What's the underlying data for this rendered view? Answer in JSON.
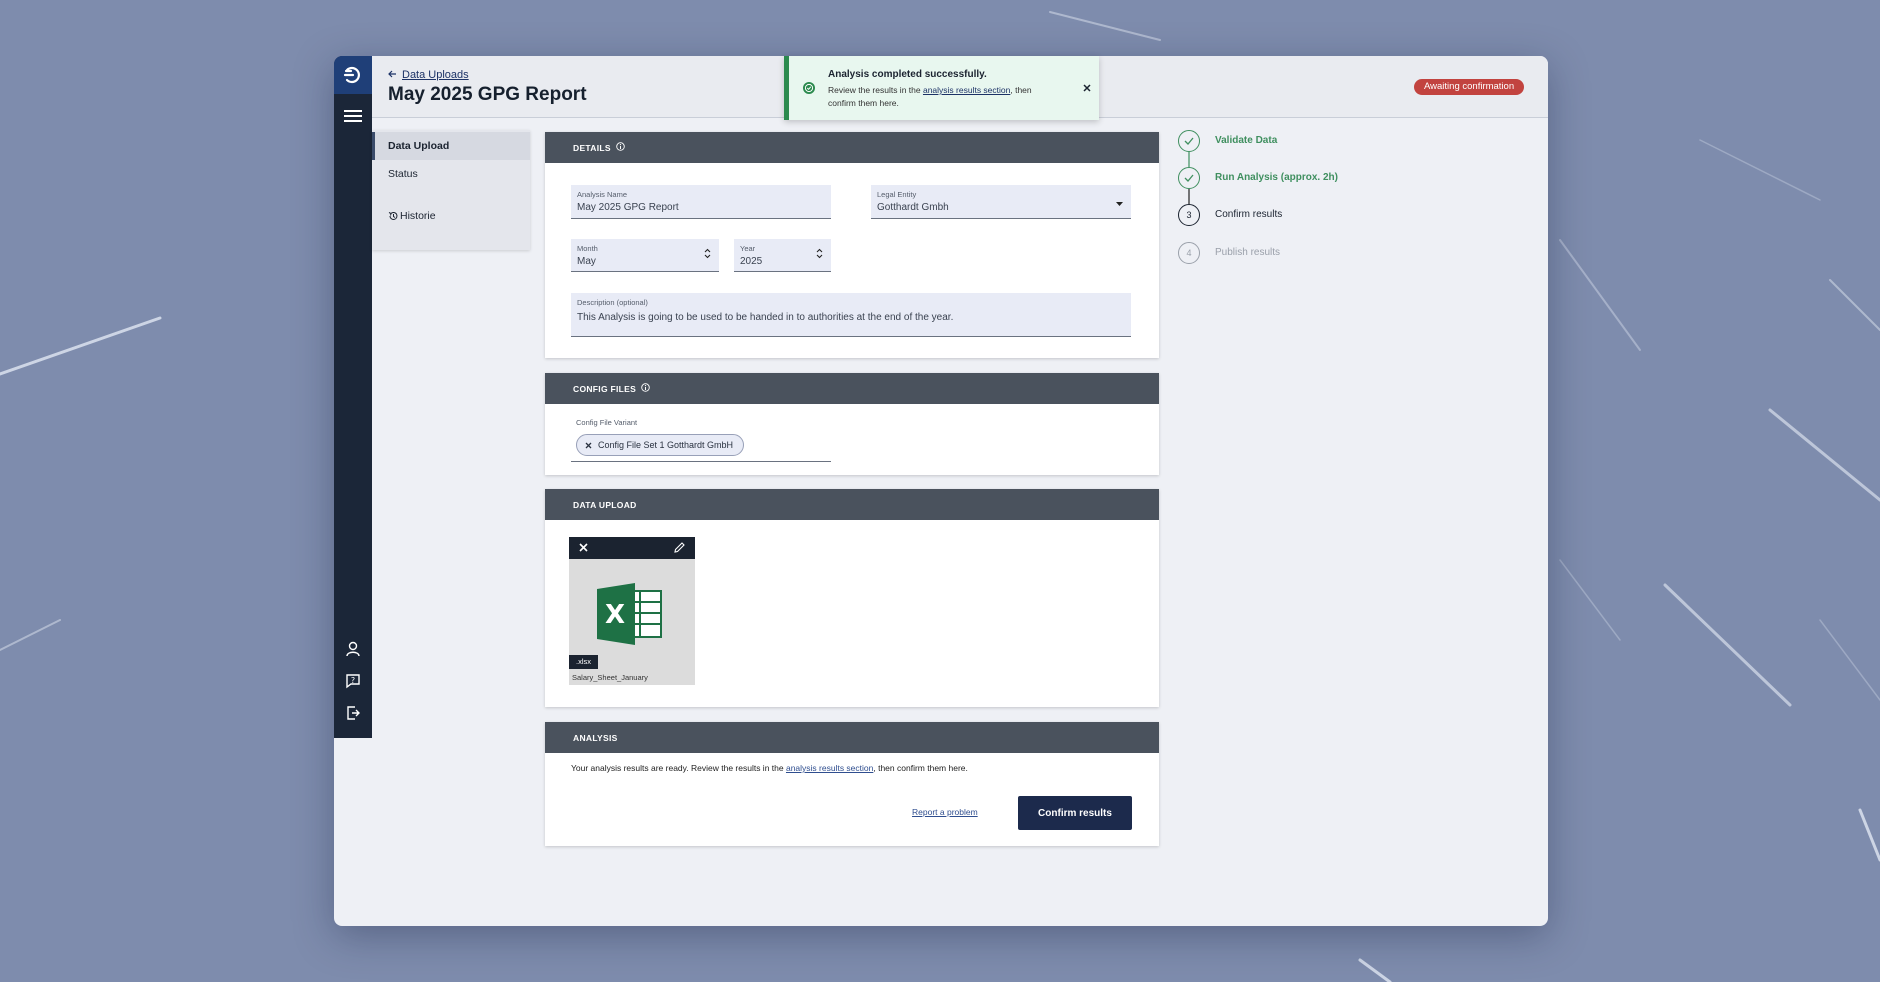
{
  "header": {
    "back_label": "Data Uploads",
    "title": "May 2025 GPG Report",
    "status": "Awaiting confirmation"
  },
  "sidenav": {
    "items": [
      {
        "label": "Data Upload"
      },
      {
        "label": "Status"
      },
      {
        "label": "Historie"
      }
    ]
  },
  "toast": {
    "title": "Analysis completed successfully.",
    "text_before": "Review the results in the ",
    "link": "analysis results section",
    "text_after": ", then confirm them here."
  },
  "details": {
    "header": "DETAILS",
    "analysis_name": {
      "label": "Analysis Name",
      "value": "May 2025 GPG Report"
    },
    "legal_entity": {
      "label": "Legal Entity",
      "value": "Gotthardt Gmbh"
    },
    "month": {
      "label": "Month",
      "value": "May"
    },
    "year": {
      "label": "Year",
      "value": "2025"
    },
    "description": {
      "label": "Description (optional)",
      "value": "This Analysis is going to be used to be handed in to authorities at the end of the year."
    }
  },
  "config_files": {
    "header": "CONFIG FILES",
    "label": "Config File Variant",
    "chip": "Config File Set 1 Gotthardt GmbH"
  },
  "data_upload": {
    "header": "DATA UPLOAD",
    "file_ext": ".xlsx",
    "file_name": "Salary_Sheet_January"
  },
  "analysis": {
    "header": "ANALYSIS",
    "text_before": "Your analysis results are ready. Review the results in the ",
    "link": "analysis results section",
    "text_after": ", then confirm them here.",
    "report_link": "Report a problem",
    "confirm_button": "Confirm  results"
  },
  "steps": [
    {
      "num": "1",
      "label": "Validate Data",
      "state": "done"
    },
    {
      "num": "2",
      "label": "Run Analysis (approx. 2h)",
      "state": "done"
    },
    {
      "num": "3",
      "label": "Confirm results",
      "state": "current"
    },
    {
      "num": "4",
      "label": "Publish results",
      "state": "pending"
    }
  ],
  "colors": {
    "accent_green": "#3f8f5f",
    "status_red": "#c2433f",
    "rail": "#1b2638",
    "primary": "#1c2a4c"
  }
}
